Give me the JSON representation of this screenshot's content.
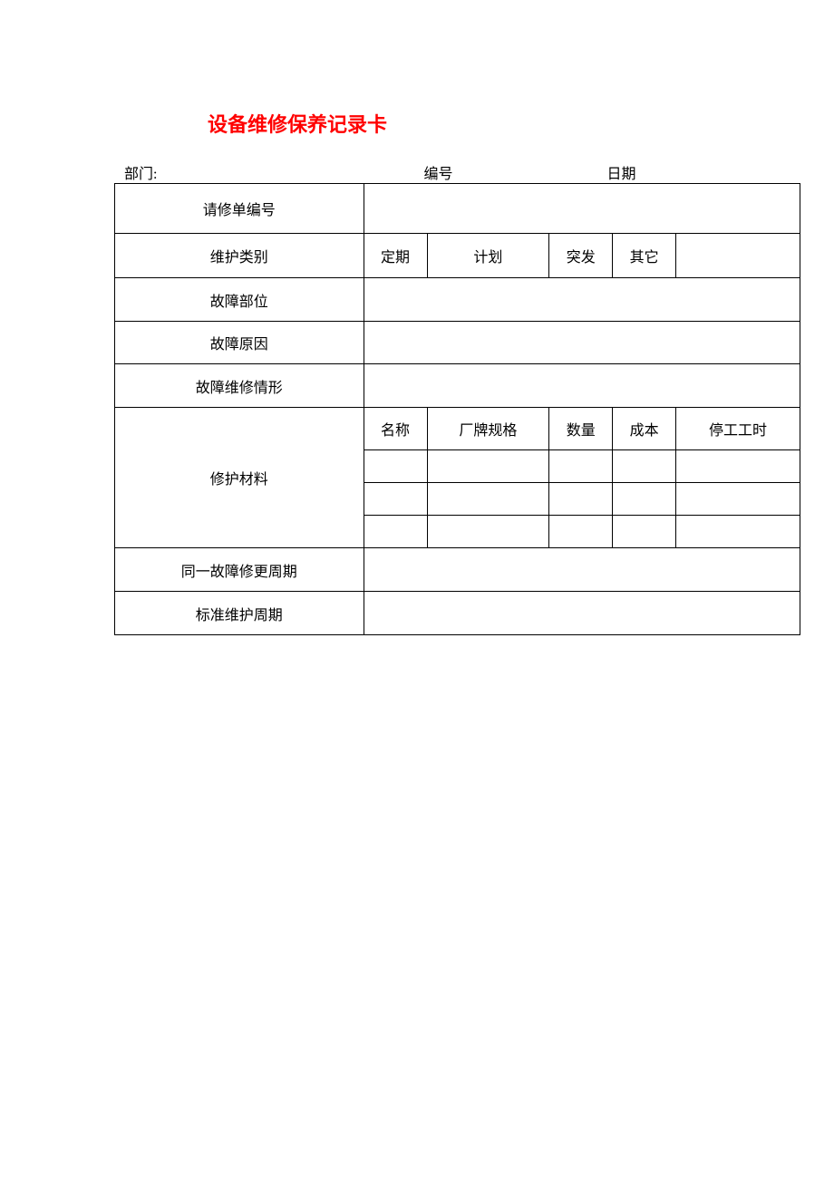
{
  "title": "设备维修保养记录卡",
  "header": {
    "department_label": "部门:",
    "number_label": "编号",
    "date_label": "日期"
  },
  "rows": {
    "request_number": "请修单编号",
    "maintenance_type": {
      "label": "维护类别",
      "opt1": "定期",
      "opt2": "计划",
      "opt3": "突发",
      "opt4": "其它"
    },
    "fault_location": "故障部位",
    "fault_reason": "故障原因",
    "fault_repair_situation": "故障维修情形",
    "repair_materials": {
      "label": "修护材料",
      "h1": "名称",
      "h2": "厂牌规格",
      "h3": "数量",
      "h4": "成本",
      "h5": "停工工时"
    },
    "same_fault_cycle": "同一故障修更周期",
    "standard_maintenance_cycle": "标准维护周期"
  }
}
